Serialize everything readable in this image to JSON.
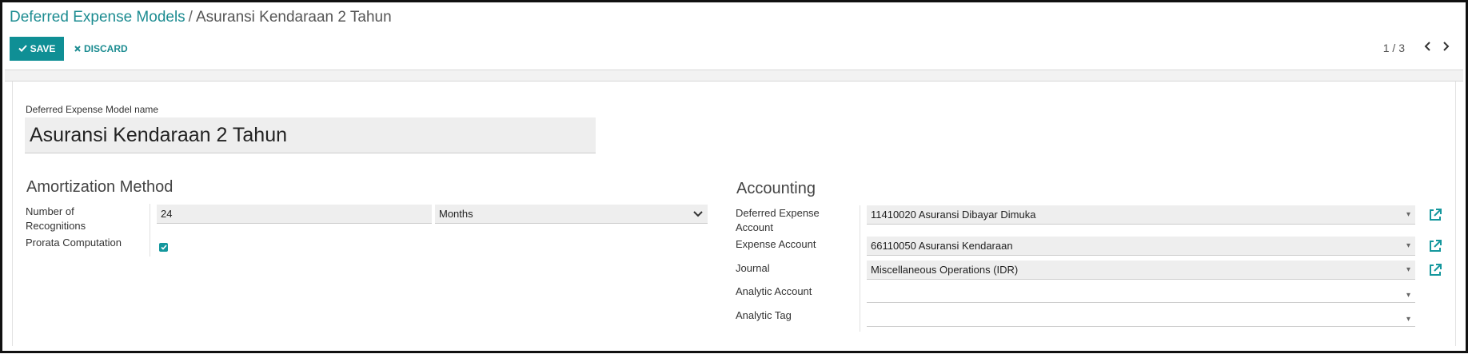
{
  "breadcrumb": {
    "parent": "Deferred Expense Models",
    "separator": "/",
    "current": "Asuransi Kendaraan 2 Tahun"
  },
  "toolbar": {
    "save_label": "SAVE",
    "discard_label": "DISCARD"
  },
  "pager": {
    "value": "1 / 3",
    "prev_icon": "chevron-left-icon",
    "next_icon": "chevron-right-icon"
  },
  "form": {
    "name_label": "Deferred Expense Model name",
    "name_value": "Asuransi Kendaraan 2 Tahun",
    "amortization": {
      "title": "Amortization Method",
      "number_label": "Number of Recognitions",
      "number_value": "24",
      "period_value": "Months",
      "prorata_label": "Prorata Computation",
      "prorata_checked": true
    },
    "accounting": {
      "title": "Accounting",
      "deferred_label": "Deferred Expense Account",
      "deferred_value": "11410020 Asuransi Dibayar Dimuka",
      "expense_label": "Expense Account",
      "expense_value": "66110050 Asuransi Kendaraan",
      "journal_label": "Journal",
      "journal_value": "Miscellaneous Operations (IDR)",
      "analytic_account_label": "Analytic Account",
      "analytic_account_value": "",
      "analytic_tag_label": "Analytic Tag",
      "analytic_tag_value": ""
    }
  },
  "colors": {
    "primary": "#0f8f95",
    "link": "#1c8c91",
    "field_bg": "#eeeeee"
  }
}
